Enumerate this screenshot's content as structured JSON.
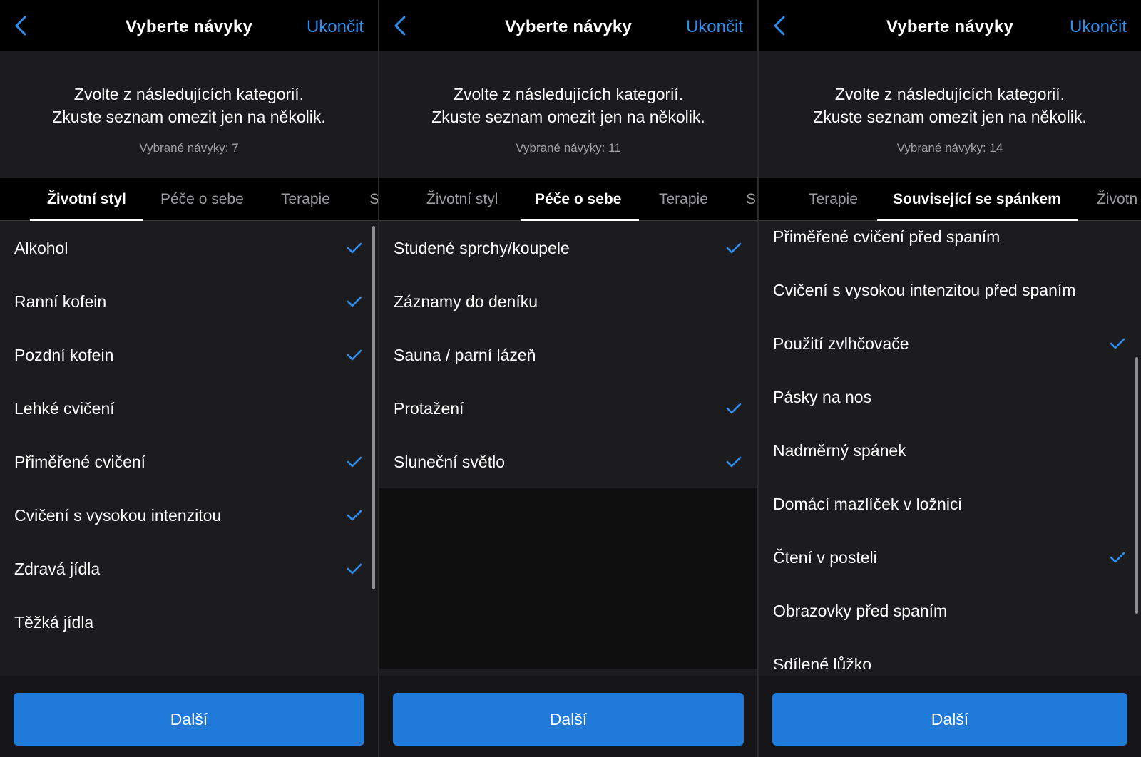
{
  "colors": {
    "accent": "#2e8ef0",
    "button": "#1f7ad9",
    "background": "#1c1c1e"
  },
  "screens": [
    {
      "title": "Vyberte návyky",
      "done_label": "Ukončit",
      "intro_line1": "Zvolte z následujících kategorií.",
      "intro_line2": "Zkuste seznam omezit jen na několik.",
      "selected_count": "Vybrané návyky: 7",
      "tabs": [
        "Životní styl",
        "Péče o sebe",
        "Terapie",
        "S"
      ],
      "active_tab": 0,
      "items": [
        {
          "label": "Alkohol",
          "checked": true
        },
        {
          "label": "Ranní kofein",
          "checked": true
        },
        {
          "label": "Pozdní kofein",
          "checked": true
        },
        {
          "label": "Lehké cvičení",
          "checked": false
        },
        {
          "label": "Přiměřené cvičení",
          "checked": true
        },
        {
          "label": "Cvičení s vysokou intenzitou",
          "checked": true
        },
        {
          "label": "Zdravá jídla",
          "checked": true
        },
        {
          "label": "Těžká jídla",
          "checked": false
        }
      ],
      "next_label": "Další"
    },
    {
      "title": "Vyberte návyky",
      "done_label": "Ukončit",
      "intro_line1": "Zvolte z následujících kategorií.",
      "intro_line2": "Zkuste seznam omezit jen na několik.",
      "selected_count": "Vybrané návyky: 11",
      "tabs": [
        "Životní styl",
        "Péče o sebe",
        "Terapie",
        "Soe"
      ],
      "active_tab": 1,
      "items": [
        {
          "label": "Studené sprchy/koupele",
          "checked": true
        },
        {
          "label": "Záznamy do deníku",
          "checked": false
        },
        {
          "label": "Sauna / parní lázeň",
          "checked": false
        },
        {
          "label": "Protažení",
          "checked": true
        },
        {
          "label": "Sluneční světlo",
          "checked": true
        }
      ],
      "next_label": "Další"
    },
    {
      "title": "Vyberte návyky",
      "done_label": "Ukončit",
      "intro_line1": "Zvolte z následujících kategorií.",
      "intro_line2": "Zkuste seznam omezit jen na několik.",
      "selected_count": "Vybrané návyky: 14",
      "tabs": [
        "Terapie",
        "Související se spánkem",
        "Životn"
      ],
      "active_tab": 1,
      "items": [
        {
          "label": "Přiměřené cvičení před spaním",
          "checked": false
        },
        {
          "label": "Cvičení s vysokou intenzitou před spaním",
          "checked": false
        },
        {
          "label": "Použití zvlhčovače",
          "checked": true
        },
        {
          "label": "Pásky na nos",
          "checked": false
        },
        {
          "label": "Nadměrný spánek",
          "checked": false
        },
        {
          "label": "Domácí mazlíček v ložnici",
          "checked": false
        },
        {
          "label": "Čtení v posteli",
          "checked": true
        },
        {
          "label": "Obrazovky před spaním",
          "checked": false
        },
        {
          "label": "Sdílené lůžko",
          "checked": false
        }
      ],
      "next_label": "Další"
    }
  ]
}
